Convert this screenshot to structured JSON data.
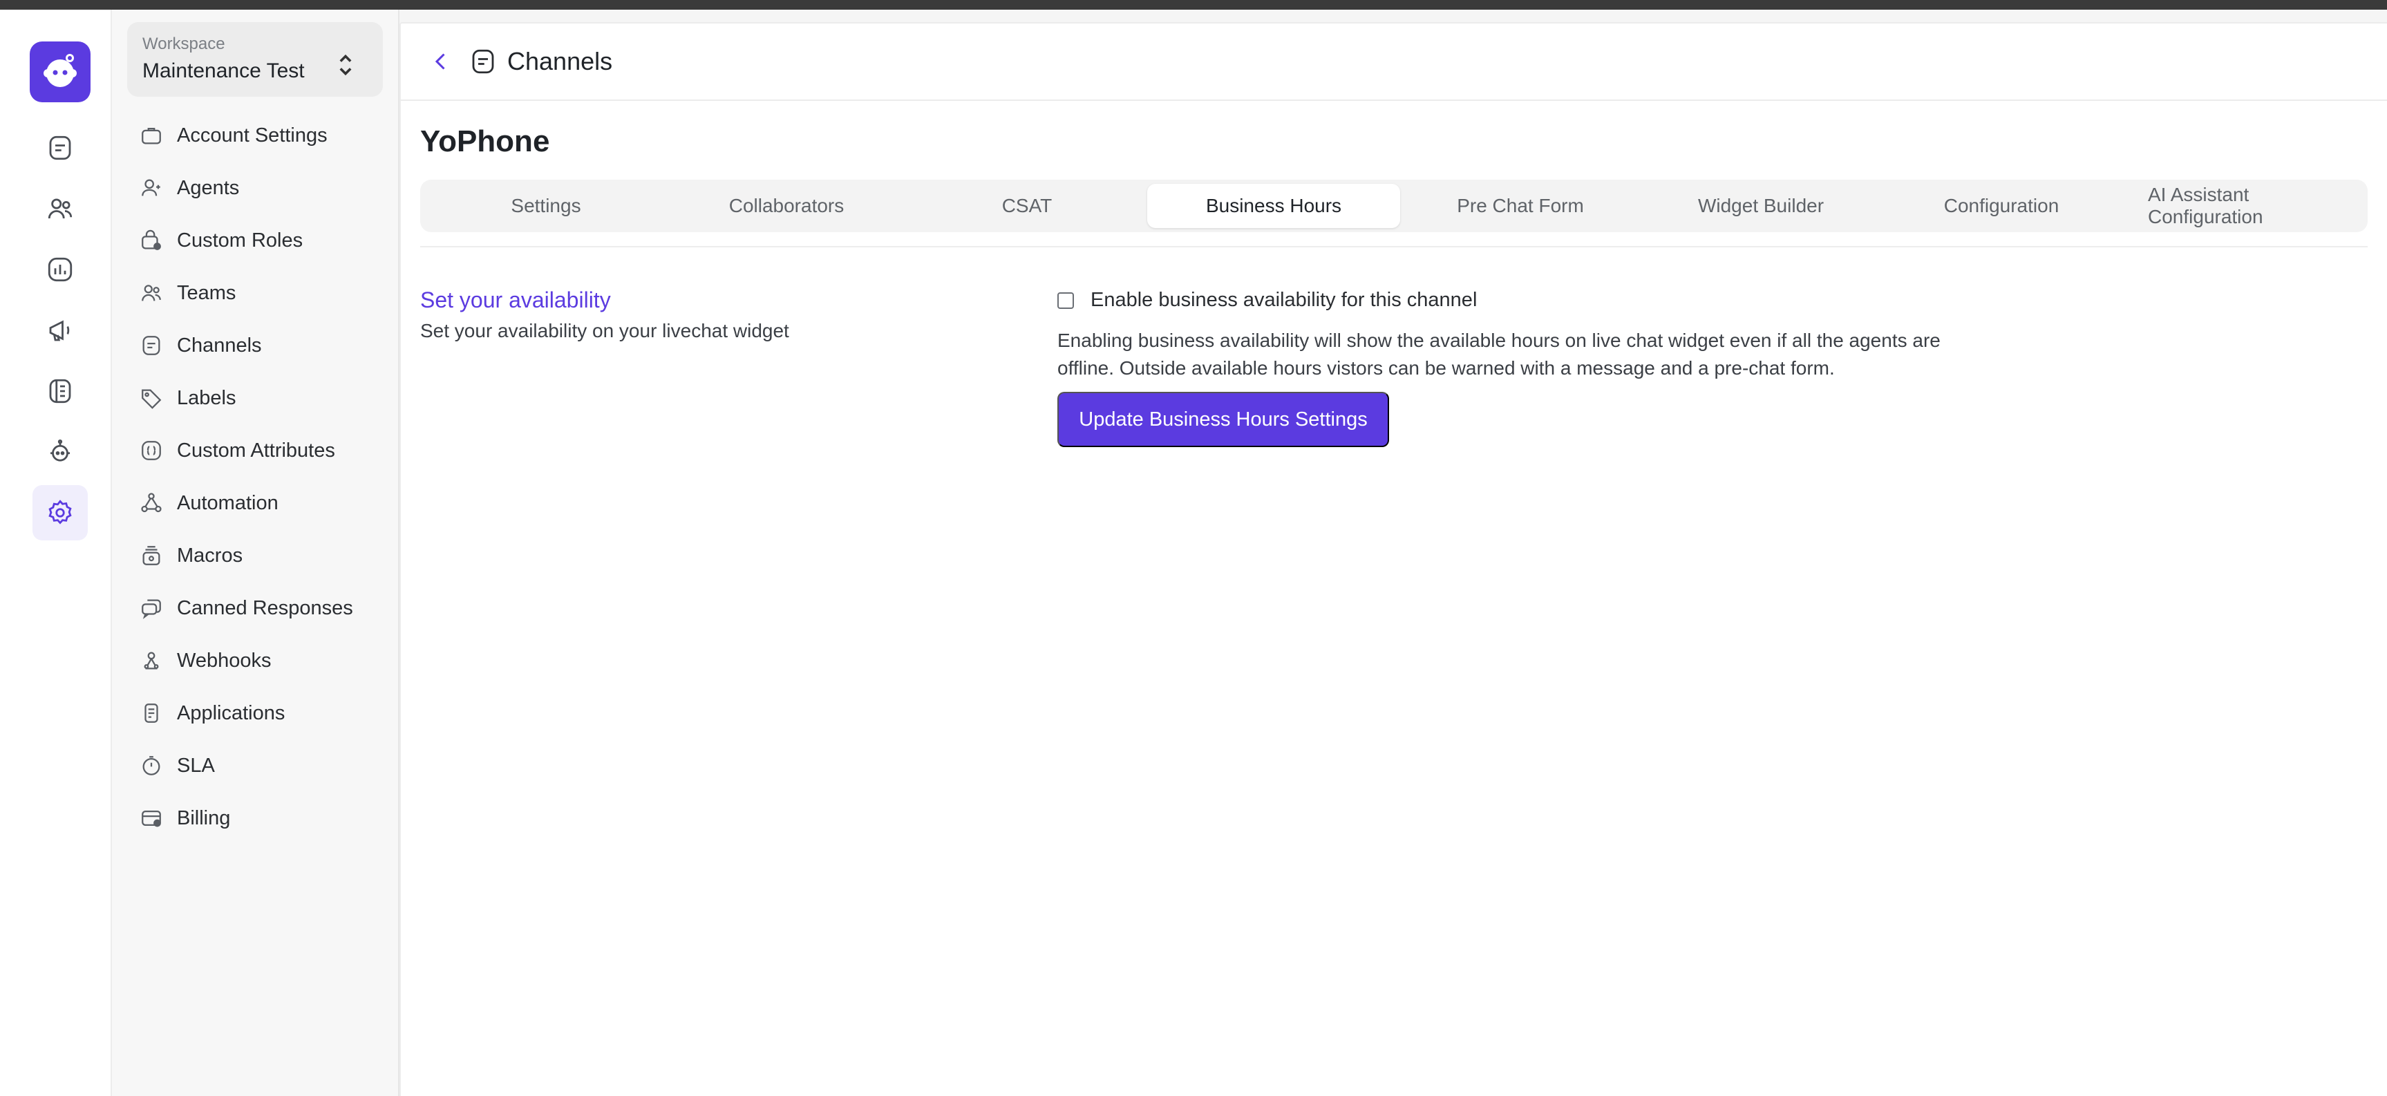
{
  "workspace": {
    "label": "Workspace",
    "name": "Maintenance Test"
  },
  "rail": {
    "items": [
      {
        "name": "conversations-icon"
      },
      {
        "name": "contacts-icon"
      },
      {
        "name": "reports-icon"
      },
      {
        "name": "campaigns-icon"
      },
      {
        "name": "help-center-icon"
      },
      {
        "name": "ai-bot-icon"
      },
      {
        "name": "settings-icon",
        "active": true
      }
    ]
  },
  "sidebar": {
    "items": [
      {
        "label": "Account Settings",
        "icon": "briefcase-icon"
      },
      {
        "label": "Agents",
        "icon": "agents-icon"
      },
      {
        "label": "Custom Roles",
        "icon": "custom-roles-icon"
      },
      {
        "label": "Teams",
        "icon": "teams-icon"
      },
      {
        "label": "Channels",
        "icon": "channels-icon"
      },
      {
        "label": "Labels",
        "icon": "tag-icon"
      },
      {
        "label": "Custom Attributes",
        "icon": "custom-attributes-icon"
      },
      {
        "label": "Automation",
        "icon": "automation-icon"
      },
      {
        "label": "Macros",
        "icon": "macros-icon"
      },
      {
        "label": "Canned Responses",
        "icon": "canned-responses-icon"
      },
      {
        "label": "Webhooks",
        "icon": "webhooks-icon"
      },
      {
        "label": "Applications",
        "icon": "applications-icon"
      },
      {
        "label": "SLA",
        "icon": "timer-icon"
      },
      {
        "label": "Billing",
        "icon": "billing-icon"
      }
    ]
  },
  "header": {
    "title": "Channels"
  },
  "page": {
    "title": "YoPhone",
    "tabs": [
      {
        "label": "Settings"
      },
      {
        "label": "Collaborators"
      },
      {
        "label": "CSAT"
      },
      {
        "label": "Business Hours",
        "active": true
      },
      {
        "label": "Pre Chat Form"
      },
      {
        "label": "Widget Builder"
      },
      {
        "label": "Configuration"
      },
      {
        "label": "AI Assistant Configuration"
      }
    ]
  },
  "availability": {
    "title": "Set your availability",
    "description": "Set your availability on your livechat widget",
    "checkbox_label": "Enable business availability for this channel",
    "checked": false,
    "help_text": "Enabling business availability will show the available hours on live chat widget even if all the agents are offline. Outside available hours vistors can be warned with a message and a pre-chat form.",
    "button_label": "Update Business Hours Settings"
  },
  "colors": {
    "accent": "#5b3be0",
    "text": "#1f2328",
    "muted": "#5f6368"
  }
}
